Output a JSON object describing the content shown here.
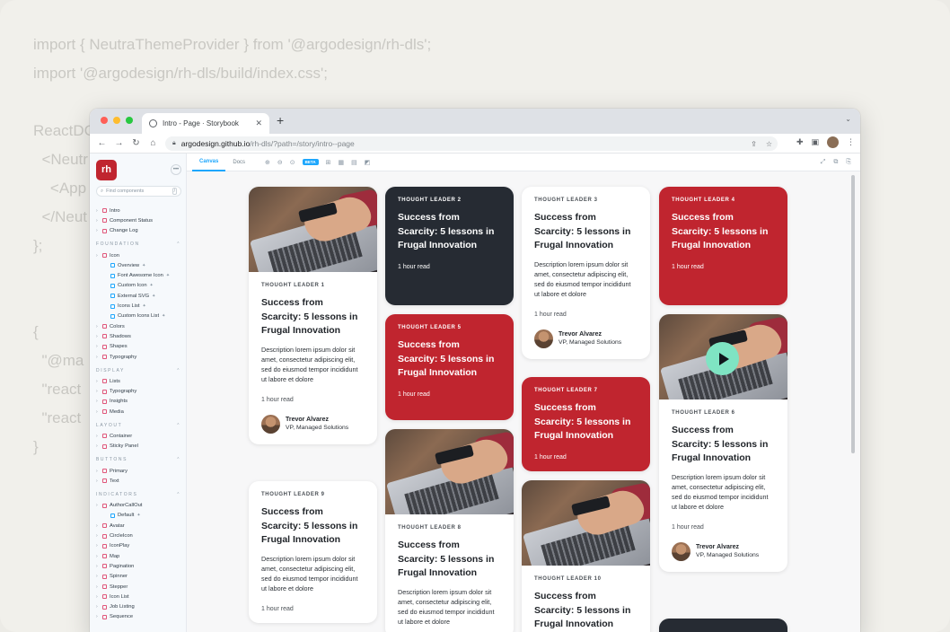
{
  "code_lines": [
    "import { NeutraThemeProvider } from '@argodesign/rh-dls';",
    "import '@argodesign/rh-dls/build/index.css';",
    "",
    "ReactDC",
    "  <Neutr",
    "    <App",
    "  </Neut",
    "};",
    "",
    "",
    "{",
    "  \"@ma",
    "  \"react",
    "  \"react",
    "}"
  ],
  "browser": {
    "tab_title": "Intro - Page · Storybook",
    "url_host": "argodesign.github.io",
    "url_path": "/rh-dls/?path=/story/intro--page"
  },
  "storybook": {
    "logo_text": "rh",
    "search_placeholder": "Find components",
    "search_shortcut": "/",
    "tabs": {
      "canvas": "Canvas",
      "docs": "Docs"
    },
    "beta_label": "BETA",
    "nav": {
      "top": [
        "Intro",
        "Component Status",
        "Change Log"
      ],
      "foundation_title": "FOUNDATION",
      "icon_group": "Icon",
      "icon_children": [
        "Overview",
        "Font Awesome Icon",
        "Custom Icon",
        "External SVG",
        "Icons List",
        "Custom Icons List"
      ],
      "foundation_rest": [
        "Colors",
        "Shadows",
        "Shapes",
        "Typography"
      ],
      "display_title": "DISPLAY",
      "display": [
        "Lists",
        "Typography",
        "Insights",
        "Media"
      ],
      "layout_title": "LAYOUT",
      "layout": [
        "Container",
        "Sticky Panel"
      ],
      "buttons_title": "BUTTONS",
      "buttons": [
        "Primary",
        "Text"
      ],
      "indicators_title": "INDICATORS",
      "authorcallout_group": "AuthorCallOut",
      "authorcallout_children": [
        "Default"
      ],
      "indicators": [
        "Avatar",
        "CircleIcon",
        "IconPlay",
        "Map",
        "Pagination",
        "Spinner",
        "Stepper",
        "Icon List",
        "Job Listing",
        "Sequence"
      ]
    }
  },
  "cards": {
    "title": "Success from Scarcity: 5 lessons in Frugal Innovation",
    "description": "Description lorem ipsum dolor sit amet, consectetur adipiscing elit, sed do eiusmod tempor incididunt ut labore et dolore",
    "read_time": "1 hour read",
    "author_name": "Trevor Alvarez",
    "author_role": "VP, Managed Solutions",
    "labels": {
      "c1": "THOUGHT LEADER 1",
      "c2": "THOUGHT LEADER 2",
      "c3": "THOUGHT LEADER 3",
      "c4": "THOUGHT LEADER 4",
      "c5": "THOUGHT LEADER 5",
      "c6": "THOUGHT LEADER 6",
      "c7": "THOUGHT LEADER 7",
      "c8": "THOUGHT LEADER 8",
      "c9": "THOUGHT LEADER 9",
      "c10": "THOUGHT LEADER 10"
    }
  },
  "colors": {
    "brand_red": "#c0252f",
    "dark_card": "#262b33",
    "play_button": "#7fe4c3",
    "storybook_blue": "#1ea7fd"
  }
}
